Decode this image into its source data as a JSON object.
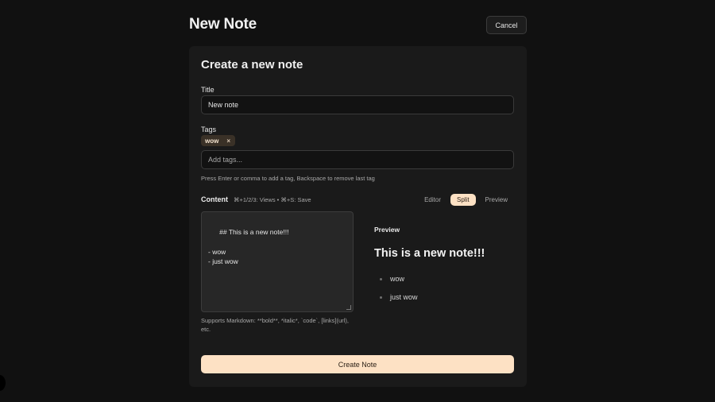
{
  "header": {
    "title": "New Note",
    "cancel_label": "Cancel"
  },
  "form": {
    "heading": "Create a new note",
    "title_label": "Title",
    "title_value": "New note",
    "tags_label": "Tags",
    "tags": [
      {
        "label": "wow",
        "remove_icon": "×"
      }
    ],
    "tags_placeholder": "Add tags...",
    "tags_hint": "Press Enter or comma to add a tag, Backspace to remove last tag",
    "content_label": "Content",
    "content_shortcuts": "⌘+1/2/3: Views • ⌘+S: Save",
    "views": [
      {
        "label": "Editor",
        "active": false
      },
      {
        "label": "Split",
        "active": true
      },
      {
        "label": "Preview",
        "active": false
      }
    ],
    "editor_value": "## This is a new note!!!\n\n- wow\n- just wow",
    "editor_hint": "Supports Markdown: **bold**, *italic*, `code`, [links](url), etc.",
    "preview": {
      "label": "Preview",
      "heading": "This is a new note!!!",
      "items": [
        "wow",
        "just wow"
      ]
    },
    "submit_label": "Create Note"
  },
  "colors": {
    "accent": "#fde1c4",
    "background": "#111111",
    "card": "#1a1a1a"
  }
}
